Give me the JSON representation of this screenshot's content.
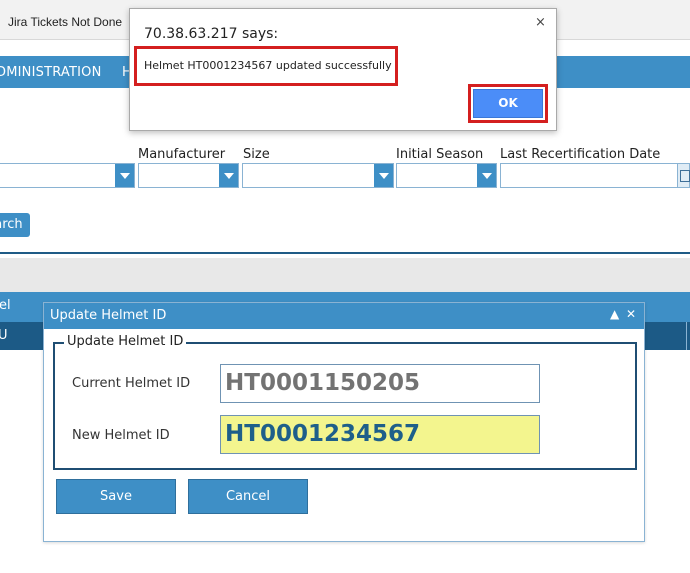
{
  "bookmarks": {
    "item": "Jira Tickets Not Done"
  },
  "nav": {
    "items": [
      "DMINISTRATION",
      "H"
    ]
  },
  "filters": {
    "labels": [
      "Manufacturer",
      "Size",
      "Initial Season",
      "Last Recertification Date"
    ],
    "search_label": "Search"
  },
  "grid": {
    "header_fragment": "el",
    "row_fragment": "U"
  },
  "update_dialog": {
    "title": "Update Helmet ID",
    "controls": [
      "▲",
      "✕"
    ],
    "legend": "Update Helmet ID",
    "current_label": "Current Helmet ID",
    "current_value": "HT0001150205",
    "new_label": "New Helmet ID",
    "new_value": "HT0001234567",
    "save_label": "Save",
    "cancel_label": "Cancel"
  },
  "alert": {
    "origin": "70.38.63.217 says:",
    "close": "×",
    "message": "Helmet HT0001234567 updated successfully",
    "ok_label": "OK"
  },
  "colors": {
    "brand_blue": "#3e8fc6",
    "dark_blue": "#1c5a86",
    "highlight_red": "#d41f1f",
    "new_id_bg": "#f3f58e",
    "ok_blue": "#4b8df8"
  }
}
